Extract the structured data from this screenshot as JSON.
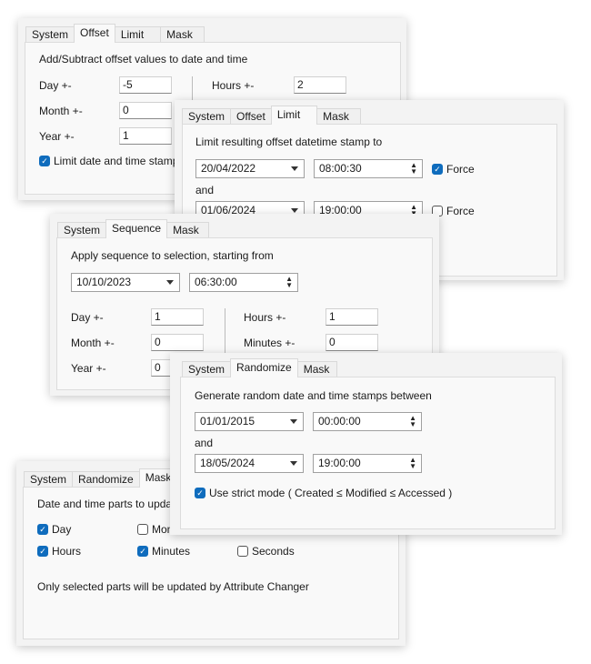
{
  "offset_panel": {
    "tabs": [
      "System",
      "Offset",
      "Limit",
      "Mask"
    ],
    "active_tab": "Offset",
    "heading": "Add/Subtract offset values to date and time",
    "day_label": "Day +-",
    "day": "-5",
    "month_label": "Month +-",
    "month": "0",
    "year_label": "Year +-",
    "year": "1",
    "hours_label": "Hours +-",
    "hours": "2",
    "limit_checkbox": "Limit date and time stamp",
    "limit_checked": true
  },
  "limit_panel": {
    "tabs": [
      "System",
      "Offset",
      "Limit",
      "Mask"
    ],
    "active_tab": "Limit",
    "heading": "Limit resulting offset datetime stamp to",
    "from_date": "20/04/2022",
    "from_time": "08:00:30",
    "from_force": "Force",
    "from_force_checked": true,
    "and": "and",
    "to_date": "01/06/2024",
    "to_time": "19:00:00",
    "to_force": "Force",
    "to_force_checked": false
  },
  "sequence_panel": {
    "tabs": [
      "System",
      "Sequence",
      "Mask"
    ],
    "active_tab": "Sequence",
    "heading": "Apply sequence to selection, starting from",
    "date": "10/10/2023",
    "time": "06:30:00",
    "day_label": "Day +-",
    "day": "1",
    "month_label": "Month +-",
    "month": "0",
    "year_label": "Year +-",
    "year": "0",
    "hours_label": "Hours +-",
    "hours": "1",
    "minutes_label": "Minutes +-",
    "minutes": "0"
  },
  "randomize_panel": {
    "tabs": [
      "System",
      "Randomize",
      "Mask"
    ],
    "active_tab": "Randomize",
    "heading": "Generate random date and time stamps between",
    "from_date": "01/01/2015",
    "from_time": "00:00:00",
    "and": "and",
    "to_date": "18/05/2024",
    "to_time": "19:00:00",
    "strict_label": "Use strict mode ( Created ≤ Modified ≤ Accessed )",
    "strict_checked": true
  },
  "mask_panel": {
    "tabs": [
      "System",
      "Randomize",
      "Mask"
    ],
    "active_tab": "Mask",
    "heading": "Date and time parts to update",
    "day": "Day",
    "month": "Month",
    "hours": "Hours",
    "minutes": "Minutes",
    "seconds": "Seconds",
    "checked": {
      "day": true,
      "month": false,
      "hours": true,
      "minutes": true,
      "seconds": false
    },
    "note": "Only selected parts will be updated by Attribute Changer"
  },
  "colors": {
    "accent": "#0f6cbd"
  }
}
